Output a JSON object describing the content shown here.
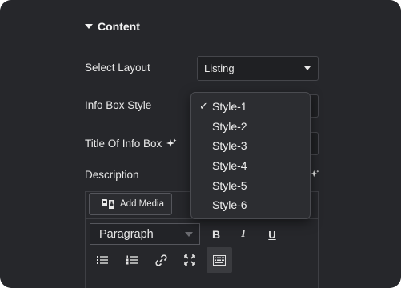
{
  "section": {
    "title": "Content",
    "expanded": true
  },
  "fields": {
    "layout": {
      "label": "Select Layout",
      "value": "Listing"
    },
    "info_box_style": {
      "label": "Info Box Style"
    },
    "title_of_info_box": {
      "label": "Title Of Info Box"
    },
    "description": {
      "label": "Description"
    }
  },
  "editor": {
    "add_media_label": "Add Media",
    "format_value": "Paragraph",
    "bold": "B",
    "italic": "I",
    "underline": "U"
  },
  "dropdown": {
    "checkmark": "✓",
    "selected": "Style-1",
    "options": [
      "Style-1",
      "Style-2",
      "Style-3",
      "Style-4",
      "Style-5",
      "Style-6"
    ]
  },
  "icons": {
    "ai_sparkle": "sparkles-icon",
    "add_media": "media-icon",
    "caret": "chevron-down-icon"
  },
  "colors": {
    "panel_bg": "#26272b",
    "field_bg": "#1f2023",
    "border": "#45464b",
    "dropdown_bg": "#2c2d31",
    "text": "#e8e8e8"
  }
}
